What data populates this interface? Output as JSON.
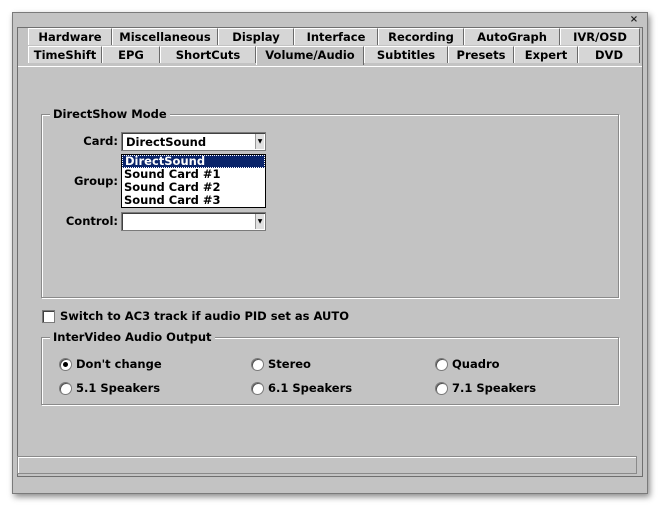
{
  "window": {
    "close_glyph": "×"
  },
  "tabs": {
    "row1": [
      "Hardware",
      "Miscellaneous",
      "Display",
      "Interface",
      "Recording",
      "AutoGraph",
      "IVR/OSD"
    ],
    "row2": [
      "TimeShift",
      "EPG",
      "ShortCuts",
      "Volume/Audio",
      "Subtitles",
      "Presets",
      "Expert",
      "DVD"
    ],
    "active": "Volume/Audio"
  },
  "directshow": {
    "title": "DirectShow Mode",
    "card_label": "Card:",
    "card_value": "DirectSound",
    "group_label": "Group:",
    "control_label": "Control:",
    "control_value": "",
    "dropdown_options": [
      "DirectSound",
      "Sound Card #1",
      "Sound Card #2",
      "Sound Card #3"
    ],
    "dropdown_selected": "DirectSound"
  },
  "ac3": {
    "label": "Switch to AC3 track if audio PID set as AUTO",
    "checked": false
  },
  "intervideo": {
    "title": "InterVideo Audio Output",
    "options": [
      "Don't change",
      "Stereo",
      "Quadro",
      "5.1 Speakers",
      "6.1 Speakers",
      "7.1 Speakers"
    ],
    "selected": "Don't change"
  },
  "statusbar": {
    "text": ""
  },
  "colors": {
    "panel": "#c3c3c3",
    "selection": "#0a246a"
  }
}
